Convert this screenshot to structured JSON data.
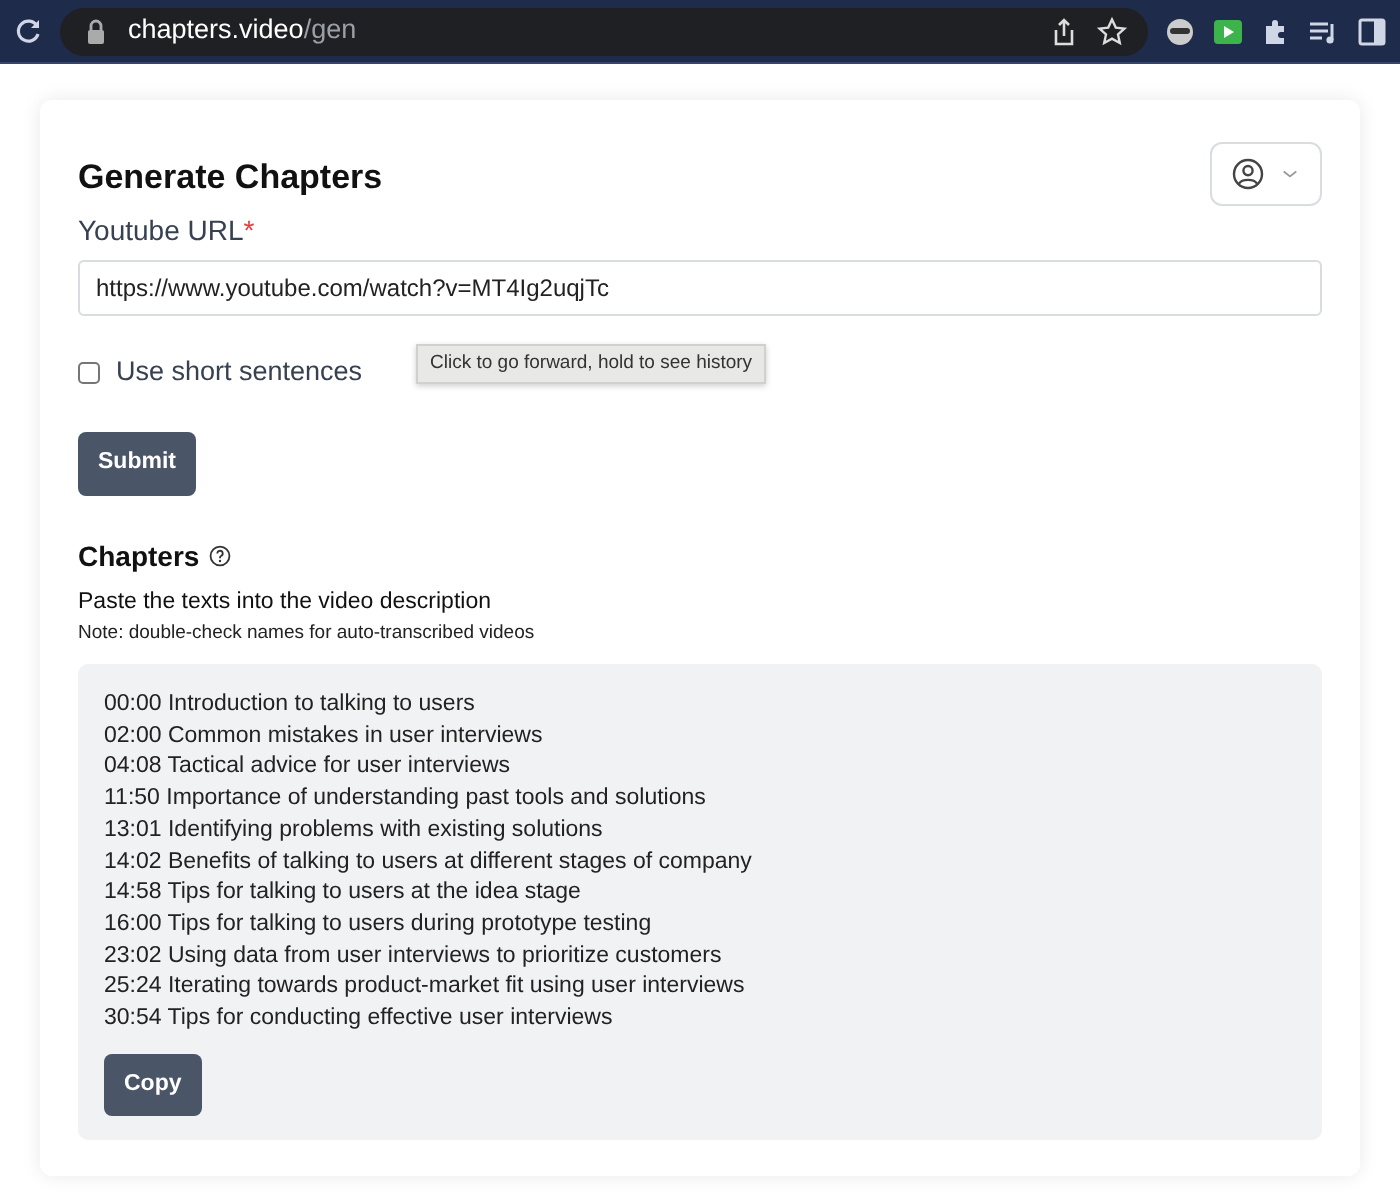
{
  "browser": {
    "url_host": "chapters.video",
    "url_path": "/gen"
  },
  "form": {
    "title": "Generate Chapters",
    "url_label": "Youtube URL",
    "required_mark": "*",
    "url_value": "https://www.youtube.com/watch?v=MT4Ig2uqjTc",
    "short_sentences": {
      "label": "Use short sentences",
      "checked": false
    },
    "submit": "Submit"
  },
  "tooltip": "Click to go forward, hold to see history",
  "chapters": {
    "title": "Chapters",
    "subtitle": "Paste the texts into the video description",
    "note": "Note: double-check names for auto-transcribed videos",
    "lines": [
      "00:00 Introduction to talking to users",
      "02:00 Common mistakes in user interviews",
      "04:08 Tactical advice for user interviews",
      "11:50 Importance of understanding past tools and solutions",
      "13:01 Identifying problems with existing solutions",
      "14:02 Benefits of talking to users at different stages of company",
      "14:58 Tips for talking to users at the idea stage",
      "16:00 Tips for talking to users during prototype testing",
      "23:02 Using data from user interviews to prioritize customers",
      "25:24 Iterating towards product-market fit using user interviews",
      "30:54 Tips for conducting effective user interviews"
    ],
    "copy": "Copy"
  }
}
